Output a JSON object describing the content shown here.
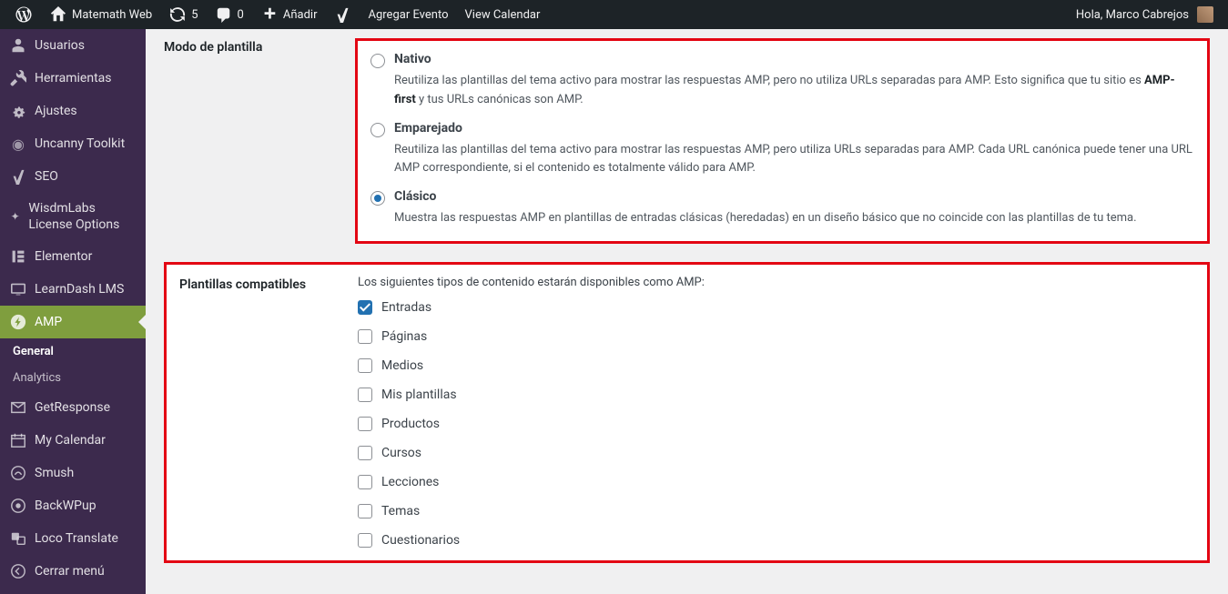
{
  "topbar": {
    "site_name": "Matemath Web",
    "updates_count": "5",
    "comments_count": "0",
    "add_new": "Añadir",
    "agregar_evento": "Agregar Evento",
    "view_calendar": "View Calendar",
    "greeting": "Hola, Marco Cabrejos"
  },
  "sidebar": {
    "items": [
      {
        "label": "Usuarios"
      },
      {
        "label": "Herramientas"
      },
      {
        "label": "Ajustes"
      },
      {
        "label": "Uncanny Toolkit"
      },
      {
        "label": "SEO"
      },
      {
        "label": "WisdmLabs License Options"
      },
      {
        "label": "Elementor"
      },
      {
        "label": "LearnDash LMS"
      },
      {
        "label": "AMP"
      }
    ],
    "subs": [
      {
        "label": "General"
      },
      {
        "label": "Analytics"
      }
    ],
    "items2": [
      {
        "label": "GetResponse"
      },
      {
        "label": "My Calendar"
      },
      {
        "label": "Smush"
      },
      {
        "label": "BackWPup"
      },
      {
        "label": "Loco Translate"
      },
      {
        "label": "Cerrar menú"
      }
    ]
  },
  "form": {
    "template_mode": {
      "label": "Modo de plantilla",
      "options": [
        {
          "title": "Nativo",
          "desc_pre": "Reutiliza las plantillas del tema activo para mostrar las respuestas AMP, pero no utiliza URLs separadas para AMP. Esto significa que tu sitio es ",
          "desc_bold": "AMP-first",
          "desc_post": " y tus URLs canónicas son AMP."
        },
        {
          "title": "Emparejado",
          "desc": "Reutiliza las plantillas del tema activo para mostrar las respuestas AMP, pero utiliza URLs separadas para AMP. Cada URL canónica puede tener una URL AMP correspondiente, si el contenido es totalmente válido para AMP."
        },
        {
          "title": "Clásico",
          "desc": "Muestra las respuestas AMP en plantillas de entradas clásicas (heredadas) en un diseño básico que no coincide con las plantillas de tu tema."
        }
      ]
    },
    "supported_templates": {
      "label": "Plantillas compatibles",
      "intro": "Los siguientes tipos de contenido estarán disponibles como AMP:",
      "items": [
        {
          "label": "Entradas",
          "checked": true
        },
        {
          "label": "Páginas",
          "checked": false
        },
        {
          "label": "Medios",
          "checked": false
        },
        {
          "label": "Mis plantillas",
          "checked": false
        },
        {
          "label": "Productos",
          "checked": false
        },
        {
          "label": "Cursos",
          "checked": false
        },
        {
          "label": "Lecciones",
          "checked": false
        },
        {
          "label": "Temas",
          "checked": false
        },
        {
          "label": "Cuestionarios",
          "checked": false
        }
      ]
    }
  }
}
